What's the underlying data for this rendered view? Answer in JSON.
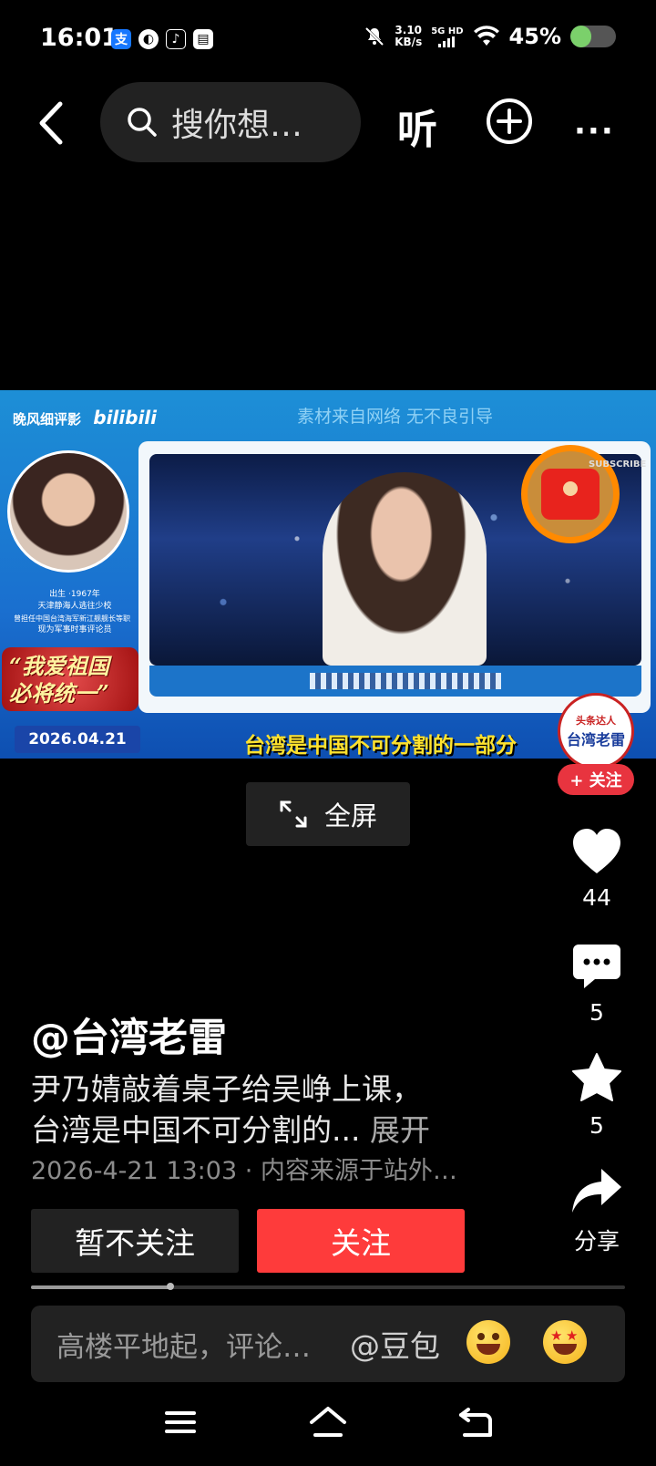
{
  "status_bar": {
    "time": "16:01",
    "net_speed_value": "3.10",
    "net_speed_unit": "KB/s",
    "net_type": "5G HD",
    "battery_text": "45%",
    "battery_level": 0.45,
    "app_icons": [
      "alipay-icon",
      "leaf-icon",
      "tiktok-icon",
      "card-icon"
    ]
  },
  "top_bar": {
    "search_placeholder": "搜你想…",
    "listen_label": "听"
  },
  "video": {
    "brand": "晚风细评影",
    "brand_logo": "bilibili",
    "notice": "素材来自网络 无不良引导",
    "bio_lines": [
      "出生 ·1967年",
      "天津静海人逃往少校",
      "曾担任中国台湾海军新江舰舰长等职",
      "现为军事时事评论员"
    ],
    "slogan": "“我爱祖国 必将统一”",
    "date": "2026.04.21",
    "subtitle": "台湾是中国不可分割的一部分",
    "subscribe": "SUBSCRIBE",
    "fullscreen_label": "全屏"
  },
  "author_avatar": {
    "top_text": "头条达人",
    "name": "台湾老雷",
    "follow_badge": "+ 关注"
  },
  "actions": {
    "likes": "44",
    "comments": "5",
    "favorites": "5",
    "share_label": "分享"
  },
  "post": {
    "author": "@台湾老雷",
    "description_line1": "尹乃婧敲着桌子给吴峥上课，",
    "description_line2": "台湾是中国不可分割的...",
    "expand_label": "展开",
    "meta": "2026-4-21 13:03 · 内容来源于站外…"
  },
  "buttons": {
    "unfollow_label": "暂不关注",
    "follow_label": "关注"
  },
  "progress": {
    "fraction": 0.235
  },
  "comment_bar": {
    "placeholder": "高楼平地起，评论…",
    "at_label": "@豆包"
  },
  "colors": {
    "follow_red": "#fe3b3b",
    "battery_green": "#7bd06b",
    "subtitle_yellow": "#ffe22e"
  }
}
